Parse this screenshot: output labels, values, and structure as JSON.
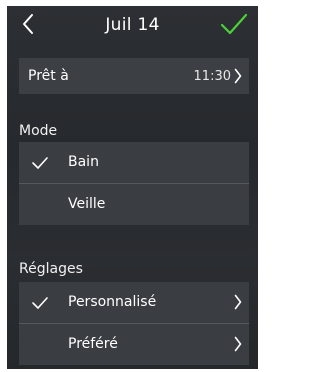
{
  "header": {
    "title": "Juil 14",
    "back_icon": "chevron-left-icon",
    "confirm_icon": "checkmark-icon",
    "confirm_color": "#4cd137"
  },
  "ready": {
    "label": "Prêt à",
    "time": "11:30"
  },
  "mode": {
    "heading": "Mode",
    "options": [
      {
        "label": "Bain",
        "selected": true
      },
      {
        "label": "Veille",
        "selected": false
      }
    ]
  },
  "settings": {
    "heading": "Réglages",
    "options": [
      {
        "label": "Personnalisé",
        "selected": true
      },
      {
        "label": "Préféré",
        "selected": false
      }
    ]
  }
}
